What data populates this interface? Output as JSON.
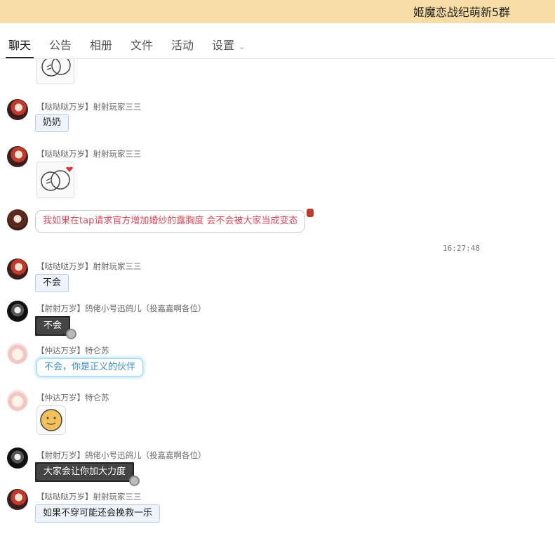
{
  "header": {
    "group_title": "姬魔恋战纪萌新5群"
  },
  "tabs": [
    {
      "label": "聊天"
    },
    {
      "label": "公告"
    },
    {
      "label": "相册"
    },
    {
      "label": "文件"
    },
    {
      "label": "活动"
    },
    {
      "label": "设置"
    }
  ],
  "messages": [
    {
      "sender": "【哒哒哒万岁】射射玩家三三",
      "text": "奶奶"
    },
    {
      "sender": "【哒哒哒万岁】射射玩家三三",
      "text": ""
    },
    {
      "sender": "",
      "text": "我如果在tap请求官方增加婚纱的露胸度 会不会被大家当成变态"
    },
    {
      "sender": "【哒哒哒万岁】射射玩家三三",
      "text": "不会"
    },
    {
      "sender": "【射射万岁】鸽佬小号迅鸽儿（投嘉嘉啊各位）",
      "text": "不会"
    },
    {
      "sender": "【仲达万岁】特仑苏",
      "text": "不会，你是正义的伙伴"
    },
    {
      "sender": "【仲达万岁】特仑苏",
      "text": ""
    },
    {
      "sender": "【射射万岁】鸽佬小号迅鸽儿（投嘉嘉啊各位）",
      "text": "大家会让你加大力度"
    },
    {
      "sender": "【哒哒哒万岁】射射玩家三三",
      "text": "如果不穿可能还会挽救一乐"
    }
  ],
  "timestamp": "16:27:48",
  "colors": {
    "header_bg": "#f7dca4",
    "pink_text": "#d14a5a",
    "glow_text": "#3a8cc9"
  }
}
